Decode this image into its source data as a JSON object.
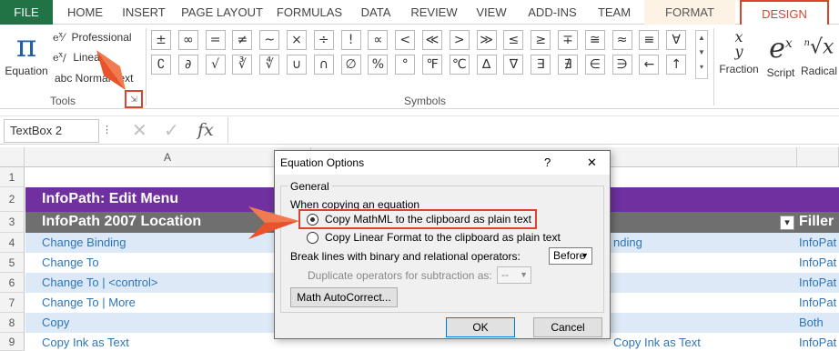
{
  "tabs": [
    "FILE",
    "HOME",
    "INSERT",
    "PAGE LAYOUT",
    "FORMULAS",
    "DATA",
    "REVIEW",
    "VIEW",
    "ADD-INS",
    "TEAM",
    "FORMAT",
    "DESIGN"
  ],
  "tools": {
    "equation_label": "Equation",
    "professional": "Professional",
    "linear": "Linear",
    "normal_text": "abc Normal Text",
    "group_label": "Tools"
  },
  "symbols": {
    "row1": [
      "±",
      "∞",
      "=",
      "≠",
      "~",
      "×",
      "÷",
      "!",
      "∝",
      "<",
      "≪",
      ">",
      "≫",
      "≤",
      "≥",
      "∓",
      "≅",
      "≈",
      "≡",
      "∀"
    ],
    "row2": [
      "∁",
      "∂",
      "√",
      "∛",
      "∜",
      "∪",
      "∩",
      "∅",
      "%",
      "°",
      "℉",
      "℃",
      "∆",
      "∇",
      "∃",
      "∄",
      "∈",
      "∋",
      "←",
      "↑"
    ],
    "group_label": "Symbols"
  },
  "structures": {
    "fraction": "Fraction",
    "script": "Script",
    "radical": "Radical"
  },
  "formula_bar": {
    "namebox": "TextBox 2",
    "fx": "fx"
  },
  "grid": {
    "col_a": "A",
    "row_numbers": [
      "1",
      "2",
      "3",
      "4",
      "5",
      "6",
      "7",
      "8",
      "9"
    ],
    "title": "InfoPath: Edit Menu",
    "header": "InfoPath 2007 Location",
    "header_right": "Filler",
    "rows": [
      "Change Binding",
      "Change To",
      "Change To | <control>",
      "Change To | More",
      "Copy",
      "Copy Ink as Text"
    ],
    "right_col": [
      "nding",
      "",
      "",
      "",
      "",
      "Copy Ink as Text"
    ],
    "filler_col": [
      "InfoPat",
      "InfoPat",
      "InfoPat",
      "InfoPat",
      "Both",
      "InfoPat"
    ]
  },
  "dialog": {
    "title": "Equation Options",
    "help": "?",
    "close": "✕",
    "general": "General",
    "when_copying": "When copying an equation",
    "opt_mathml": "Copy MathML to the clipboard as plain text",
    "opt_linear": "Copy Linear Format to the clipboard as plain text",
    "break_lines_label": "Break lines with binary and relational operators:",
    "break_lines_value": "Before",
    "dup_label": "Duplicate operators for subtraction as:",
    "dup_value": "--",
    "autocorrect": "Math AutoCorrect...",
    "ok": "OK",
    "cancel": "Cancel"
  },
  "colors": {
    "accent": "#217346",
    "highlight": "#d9452a",
    "title_bg": "#7030a0",
    "header_bg": "#6f6f6f",
    "arrow": "#e8532b"
  }
}
